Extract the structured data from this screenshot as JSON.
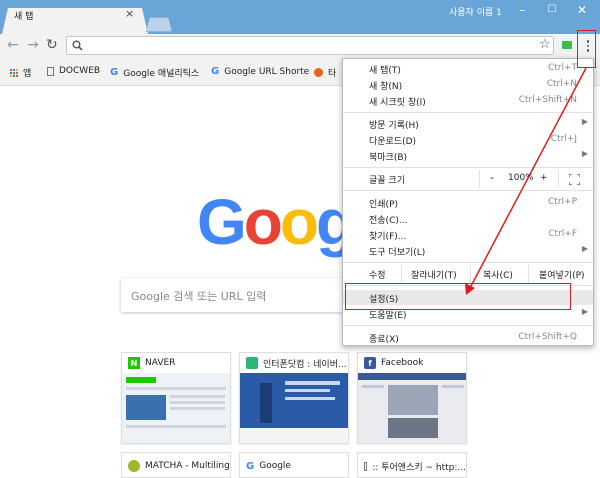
{
  "window": {
    "tab_title": "새 탭",
    "profile_name": "사용자 이름 1"
  },
  "toolbar": {
    "omnibox_value": ""
  },
  "bookmarks": [
    {
      "label": "앱",
      "icon": "apps-grid-icon"
    },
    {
      "label": "DOCWEB",
      "icon": "document-icon"
    },
    {
      "label": "Google 애널리틱스",
      "icon": "google-g-icon"
    },
    {
      "label": "Google URL Shorte",
      "icon": "google-g-icon"
    },
    {
      "label": "타",
      "icon": "orange-circle-icon"
    }
  ],
  "ntp": {
    "logo": "Google",
    "search_placeholder": "Google 검색 또는 URL 입력",
    "tiles": [
      {
        "title": "NAVER",
        "fav_letter": "N",
        "fav_color": "#1ec800"
      },
      {
        "title": "인터폰닷컴 : 네이버...",
        "fav_letter": "",
        "fav_color": "#2bb673"
      },
      {
        "title": "Facebook",
        "fav_letter": "f",
        "fav_color": "#3b5998"
      },
      {
        "title": "MATCHA - Multiling...",
        "fav_letter": "",
        "fav_color": "#a0b72a"
      },
      {
        "title": "Google",
        "fav_letter": "G",
        "fav_color": "#ffffff"
      },
      {
        "title": ":: 투어앤스키 ~ http:...",
        "fav_letter": "",
        "fav_color": "#ffffff"
      }
    ]
  },
  "menu": {
    "new_tab": {
      "label": "새 탭(T)",
      "shortcut": "Ctrl+T"
    },
    "new_window": {
      "label": "새 창(N)",
      "shortcut": "Ctrl+N"
    },
    "incognito": {
      "label": "새 시크릿 창(I)",
      "shortcut": "Ctrl+Shift+N"
    },
    "history": {
      "label": "방문 기록(H)"
    },
    "downloads": {
      "label": "다운로드(D)",
      "shortcut": "Ctrl+J"
    },
    "bookmarks": {
      "label": "북마크(B)"
    },
    "zoom": {
      "label": "글꼴 크기",
      "minus": "-",
      "value": "100%",
      "plus": "+"
    },
    "print": {
      "label": "인쇄(P)",
      "shortcut": "Ctrl+P"
    },
    "cast": {
      "label": "전송(C)..."
    },
    "find": {
      "label": "찾기(F)...",
      "shortcut": "Ctrl+F"
    },
    "more_tools": {
      "label": "도구 더보기(L)"
    },
    "edit": {
      "label": "수정",
      "cut": "잘라내기(T)",
      "copy": "복사(C)",
      "paste": "붙여넣기(P)"
    },
    "settings": {
      "label": "설정(S)"
    },
    "help": {
      "label": "도움말(E)"
    },
    "exit": {
      "label": "종료(X)",
      "shortcut": "Ctrl+Shift+Q"
    }
  },
  "colors": {
    "annotation_red": "#e01b1b",
    "titlebar": "#6aa5d8"
  }
}
